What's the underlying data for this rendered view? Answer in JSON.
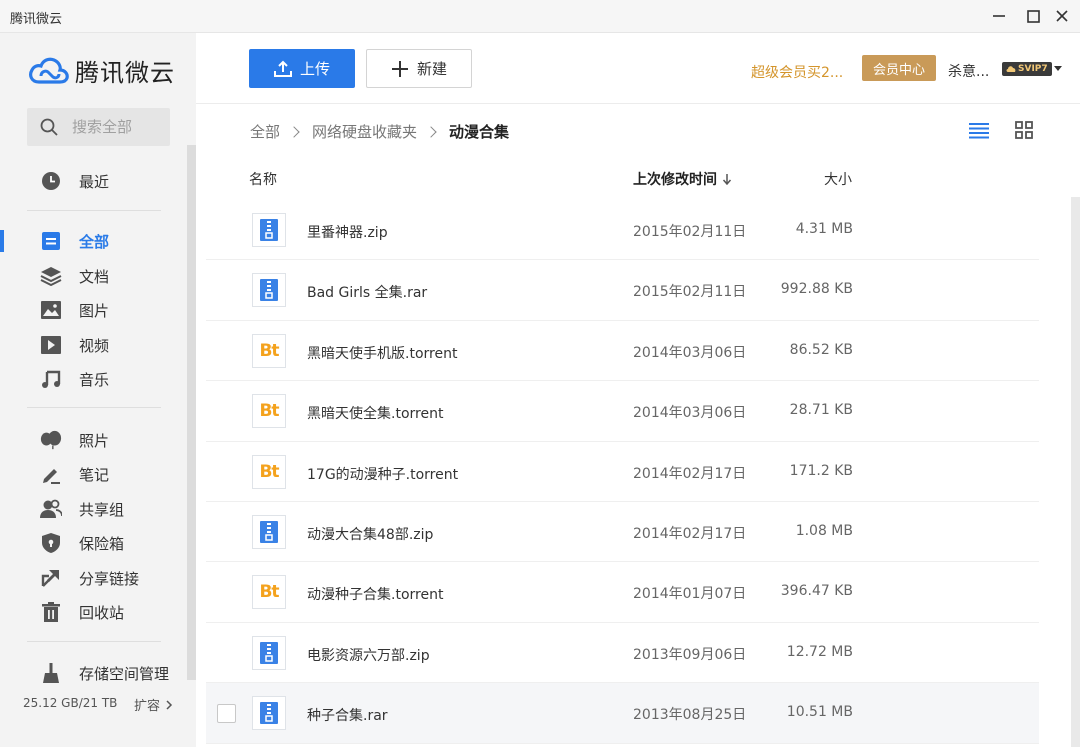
{
  "window": {
    "title": "腾讯微云"
  },
  "sidebar": {
    "logo_text": "腾讯微云",
    "search_placeholder": "搜索全部",
    "items": [
      {
        "label": "最近",
        "icon": "clock-icon"
      },
      {
        "label": "全部",
        "icon": "all-files-icon",
        "active": true
      },
      {
        "label": "文档",
        "icon": "stack-icon"
      },
      {
        "label": "图片",
        "icon": "image-icon"
      },
      {
        "label": "视频",
        "icon": "play-icon"
      },
      {
        "label": "音乐",
        "icon": "music-note-icon"
      },
      {
        "label": "照片",
        "icon": "balloon-icon"
      },
      {
        "label": "笔记",
        "icon": "pen-icon"
      },
      {
        "label": "共享组",
        "icon": "group-icon"
      },
      {
        "label": "保险箱",
        "icon": "shield-icon"
      },
      {
        "label": "分享链接",
        "icon": "share-icon"
      },
      {
        "label": "回收站",
        "icon": "trash-icon"
      },
      {
        "label": "存储空间管理",
        "icon": "broom-icon"
      }
    ],
    "storage_usage": "25.12 GB/21 TB",
    "expand_label": "扩容"
  },
  "toolbar": {
    "upload_label": "上传",
    "new_label": "新建",
    "promo_text": "超级会员买2...",
    "member_center_label": "会员中心",
    "username": "杀意...",
    "vip_badge": "SVIP7"
  },
  "breadcrumb": [
    "全部",
    "网络硬盘收藏夹",
    "动漫合集"
  ],
  "columns": {
    "name": "名称",
    "modified": "上次修改时间",
    "size": "大小"
  },
  "files": [
    {
      "name": "里番神器.zip",
      "type": "zip",
      "modified": "2015年02月11日",
      "size": "4.31 MB"
    },
    {
      "name": "Bad Girls 全集.rar",
      "type": "zip",
      "modified": "2015年02月11日",
      "size": "992.88 KB"
    },
    {
      "name": "黑暗天使手机版.torrent",
      "type": "bt",
      "modified": "2014年03月06日",
      "size": "86.52 KB"
    },
    {
      "name": "黑暗天使全集.torrent",
      "type": "bt",
      "modified": "2014年03月06日",
      "size": "28.71 KB"
    },
    {
      "name": "17G的动漫种子.torrent",
      "type": "bt",
      "modified": "2014年02月17日",
      "size": "171.2 KB"
    },
    {
      "name": "动漫大合集48部.zip",
      "type": "zip",
      "modified": "2014年02月17日",
      "size": "1.08 MB"
    },
    {
      "name": "动漫种子合集.torrent",
      "type": "bt",
      "modified": "2014年01月07日",
      "size": "396.47 KB"
    },
    {
      "name": "电影资源六万部.zip",
      "type": "zip",
      "modified": "2013年09月06日",
      "size": "12.72 MB"
    },
    {
      "name": "种子合集.rar",
      "type": "zip",
      "modified": "2013年08月25日",
      "size": "10.51 MB",
      "hover": true
    }
  ],
  "colors": {
    "accent": "#2a7ae8",
    "bt": "#f4a21d",
    "gold": "#c99a58",
    "promo": "#d4952c"
  }
}
